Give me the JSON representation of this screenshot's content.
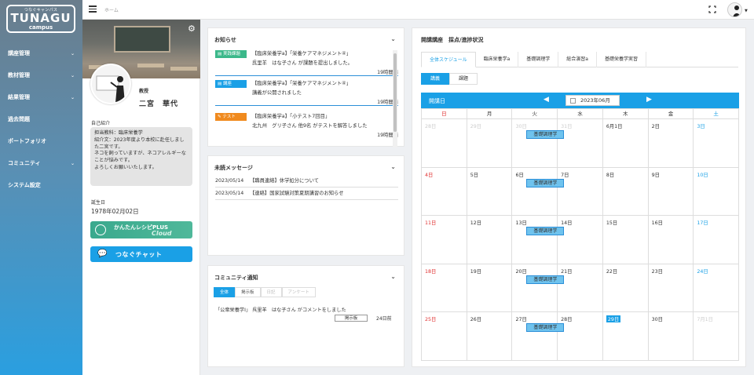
{
  "logo": {
    "sub": "つなぐキャンパス",
    "main": "TUNAGU",
    "campus": "campus"
  },
  "sidebar": {
    "items": [
      {
        "label": "講座管理",
        "chevron": true
      },
      {
        "label": "教材管理",
        "chevron": true
      },
      {
        "label": "結果管理",
        "chevron": true
      },
      {
        "label": "過去問題",
        "chevron": false
      },
      {
        "label": "ポートフォリオ",
        "chevron": false
      },
      {
        "label": "コミュニティ",
        "chevron": true
      },
      {
        "label": "システム設定",
        "chevron": false
      }
    ]
  },
  "topbar": {
    "breadcrumb": "ホーム"
  },
  "profile": {
    "role": "教授",
    "name": "二宮　華代",
    "intro_label": "自己紹介",
    "intro": "担当教科：臨床栄養学\n紹介文：2023年度より本校に赴任しました二宮です。\nネコを飼っていますが、ネコアレルギーなことが悩みです。\nよろしくお願いいたします。",
    "birthday_label": "誕生日",
    "birthday": "1978年02月02日",
    "recipe_button": {
      "line1": "かんたんレシピPLUS",
      "line2": "Cloud"
    },
    "chat_button": "つなぐチャット"
  },
  "news": {
    "title": "お知らせ",
    "items": [
      {
        "tag": "実践課題",
        "tag_color": "#3bb88a",
        "line1": "【臨床栄養学a】「栄養ケアマネジメント④」",
        "line2": "呉里羊　はな子さん が課題を提出しました。",
        "time": "19時間前"
      },
      {
        "tag": "講座",
        "tag_color": "#1aa0e6",
        "line1": "【臨床栄養学a】「栄養ケアマネジメント④」",
        "line2": "講義が公開されました",
        "time": "19時間前"
      },
      {
        "tag": "テスト",
        "tag_color": "#f08a1e",
        "line1": "【臨床栄養学a】「小テスト7回目」",
        "line2": "北九州　グリ子さん 他9名 がテストを解答しました",
        "time": "19時間前"
      }
    ]
  },
  "messages": {
    "title": "未読メッセージ",
    "items": [
      {
        "date": "2023/05/14",
        "title": "【職員連絡】休学処分について"
      },
      {
        "date": "2023/05/14",
        "title": "【連絡】国家試験対策夏期講習のお知らせ"
      }
    ]
  },
  "community": {
    "title": "コミュニティ通知",
    "tabs": [
      "全体",
      "掲示板",
      "日記",
      "アンケート"
    ],
    "item": {
      "text": "「公衆栄養学Ⅰ」 呉里羊　はな子さん がコメントをしました",
      "chip": "掲示板",
      "time": "24日前"
    }
  },
  "schedule": {
    "title": "開講講座　採点/進捗状況",
    "tabs": [
      "全体スケジュール",
      "臨床栄養学a",
      "基礎調理学",
      "総合演習a",
      "基礎栄養学実習"
    ],
    "subtabs": [
      "講義",
      "課題"
    ],
    "header_label": "開講日",
    "month": "2023年06月",
    "weekdays": [
      "日",
      "月",
      "火",
      "水",
      "木",
      "金",
      "土"
    ],
    "event_label": "基礎調理学",
    "weeks": [
      [
        "28日",
        "29日",
        "30日",
        "31日",
        "6月1日",
        "2日",
        "3日"
      ],
      [
        "4日",
        "5日",
        "6日",
        "7日",
        "8日",
        "9日",
        "10日"
      ],
      [
        "11日",
        "12日",
        "13日",
        "14日",
        "15日",
        "16日",
        "17日"
      ],
      [
        "18日",
        "19日",
        "20日",
        "21日",
        "22日",
        "23日",
        "24日"
      ],
      [
        "25日",
        "26日",
        "27日",
        "28日",
        "29日",
        "30日",
        "7月1日"
      ]
    ]
  },
  "colors": {
    "accent": "#1aa0e6",
    "sunday": "#e03030",
    "saturday": "#1aa0e6"
  }
}
